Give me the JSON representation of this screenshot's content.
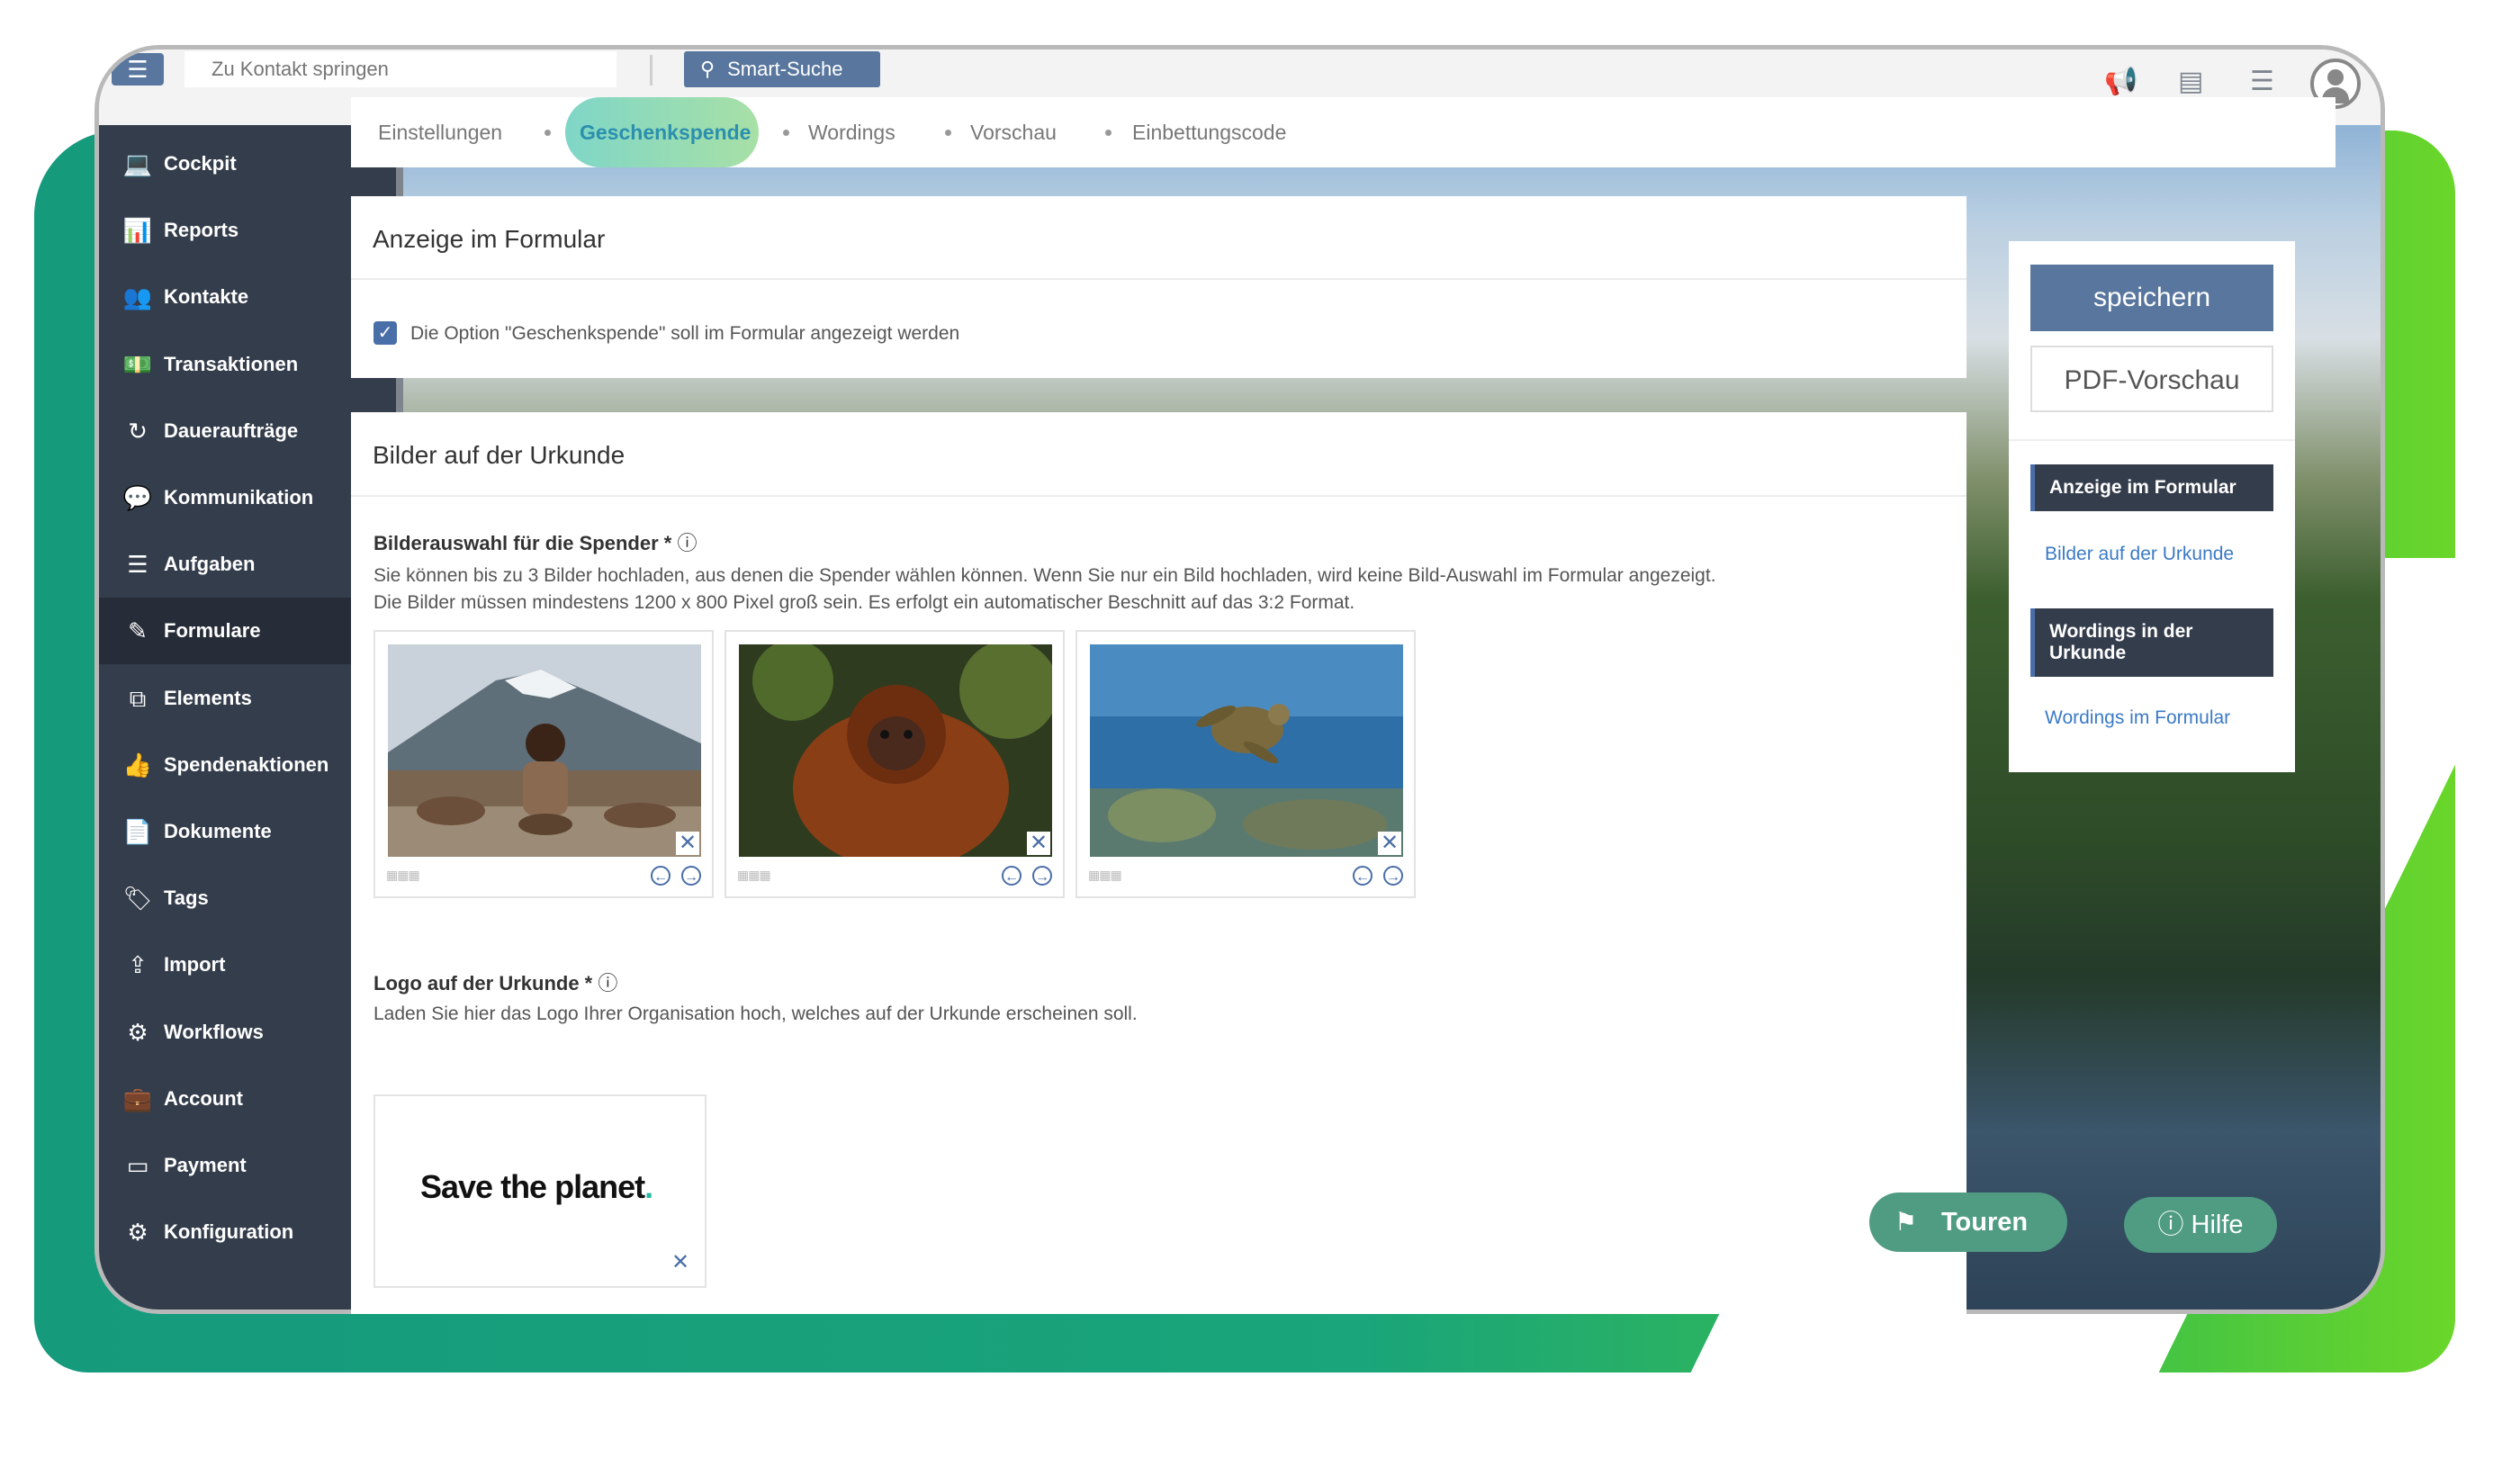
{
  "topbar": {
    "jump_placeholder": "Zu Kontakt springen",
    "smart_search_label": "Smart-Suche",
    "icons": [
      "menu-icon",
      "search-icon",
      "megaphone-icon",
      "news-icon",
      "tasks-icon",
      "user-icon"
    ]
  },
  "sidebar": {
    "items": [
      {
        "label": "Cockpit",
        "icon": "laptop-icon",
        "submenu": false
      },
      {
        "label": "Reports",
        "icon": "chart-icon",
        "submenu": false
      },
      {
        "label": "Kontakte",
        "icon": "users-icon",
        "submenu": false
      },
      {
        "label": "Transaktionen",
        "icon": "money-icon",
        "submenu": false
      },
      {
        "label": "Daueraufträge",
        "icon": "recurring-icon",
        "submenu": false
      },
      {
        "label": "Kommunikation",
        "icon": "chat-icon",
        "submenu": false
      },
      {
        "label": "Aufgaben",
        "icon": "checklist-icon",
        "submenu": false
      },
      {
        "label": "Formulare",
        "icon": "edit-icon",
        "submenu": false,
        "active": true
      },
      {
        "label": "Elements",
        "icon": "puzzle-icon",
        "submenu": false
      },
      {
        "label": "Spendenaktionen",
        "icon": "thumbs-up-icon",
        "submenu": true
      },
      {
        "label": "Dokumente",
        "icon": "document-icon",
        "submenu": true
      },
      {
        "label": "Tags",
        "icon": "tag-icon",
        "submenu": true
      },
      {
        "label": "Import",
        "icon": "upload-icon",
        "submenu": false
      },
      {
        "label": "Workflows",
        "icon": "robot-icon",
        "submenu": true
      },
      {
        "label": "Account",
        "icon": "briefcase-icon",
        "submenu": true
      },
      {
        "label": "Payment",
        "icon": "card-icon",
        "submenu": true
      },
      {
        "label": "Konfiguration",
        "icon": "gear-icon",
        "submenu": true
      }
    ]
  },
  "tabs": {
    "items": [
      "Einstellungen",
      "Geschenkspende",
      "Wordings",
      "Vorschau",
      "Einbettungscode"
    ],
    "active": "Geschenkspende"
  },
  "panel1": {
    "title": "Anzeige im Formular",
    "checkbox_label": "Die Option \"Geschenkspende\" soll im Formular angezeigt werden",
    "checked": true
  },
  "panel2": {
    "title": "Bilder auf der Urkunde",
    "images_label": "Bilderauswahl für die Spender *",
    "images_help_1": "Sie können bis zu 3 Bilder hochladen, aus denen die Spender wählen können. Wenn Sie nur ein Bild hochladen, wird keine Bild-Auswahl im Formular angezeigt.",
    "images_help_2": "Die Bilder müssen mindestens 1200 x 800 Pixel groß sein. Es erfolgt ein automatischer Beschnitt auf das 3:2 Format.",
    "images": [
      "child-with-pottery-image",
      "orangutan-image",
      "sea-turtle-image"
    ],
    "logo_label": "Logo auf der Urkunde *",
    "logo_help": "Laden Sie hier das Logo Ihrer Organisation hoch, welches auf der Urkunde erscheinen soll.",
    "logo_text": "Save the planet",
    "logo_dot": "."
  },
  "right_panel": {
    "save_label": "speichern",
    "pdf_label": "PDF-Vorschau",
    "nav": [
      {
        "label": "Anzeige im Formular",
        "style": "dark"
      },
      {
        "label": "Bilder auf der Urkunde",
        "style": "link"
      },
      {
        "label": "Wordings in der Urkunde",
        "style": "dark"
      },
      {
        "label": "Wordings im Formular",
        "style": "link"
      }
    ]
  },
  "bottom": {
    "touren_label": "Touren",
    "hilfe_label": "Hilfe"
  },
  "colors": {
    "sidebar_bg": "#343d4b",
    "primary_button": "#58769e",
    "accent_green": "#4f9c83",
    "link_blue": "#3b7ac5"
  }
}
